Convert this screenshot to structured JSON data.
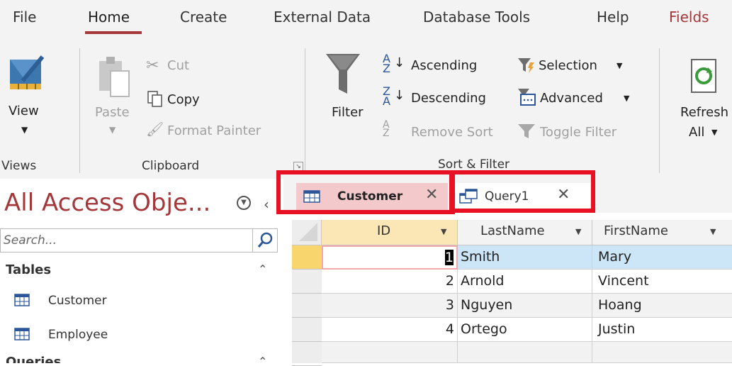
{
  "menu": {
    "tabs": [
      "File",
      "Home",
      "Create",
      "External Data",
      "Database Tools",
      "Help",
      "Fields"
    ]
  },
  "ribbon": {
    "view_label": "View",
    "paste_label": "Paste",
    "cut_label": "Cut",
    "copy_label": "Copy",
    "format_painter_label": "Format Painter",
    "filter_label": "Filter",
    "ascending_label": "Ascending",
    "descending_label": "Descending",
    "remove_sort_label": "Remove Sort",
    "selection_label": "Selection",
    "advanced_label": "Advanced",
    "toggle_filter_label": "Toggle Filter",
    "refresh_label": "Refresh",
    "refresh_all_label": "All",
    "groups": {
      "views": "Views",
      "clipboard": "Clipboard",
      "sort_filter": "Sort & Filter"
    }
  },
  "nav": {
    "title": "All Access Obje...",
    "search_placeholder": "Search...",
    "tables_header": "Tables",
    "items": [
      "Customer",
      "Employee"
    ],
    "queries_header": "Queries"
  },
  "doc_tabs": {
    "customer": "Customer",
    "query1": "Query1"
  },
  "datasheet": {
    "columns": [
      "ID",
      "LastName",
      "FirstName"
    ],
    "rows": [
      [
        "1",
        "Smith",
        "Mary"
      ],
      [
        "2",
        "Arnold",
        "Vincent"
      ],
      [
        "3",
        "Nguyen",
        "Hoang"
      ],
      [
        "4",
        "Ortego",
        "Justin"
      ]
    ]
  },
  "colors": {
    "accent": "#a4373a",
    "highlight_box": "#e81123",
    "selected_row": "#cde6f7",
    "active_tab_bg": "#f4c9cb"
  }
}
